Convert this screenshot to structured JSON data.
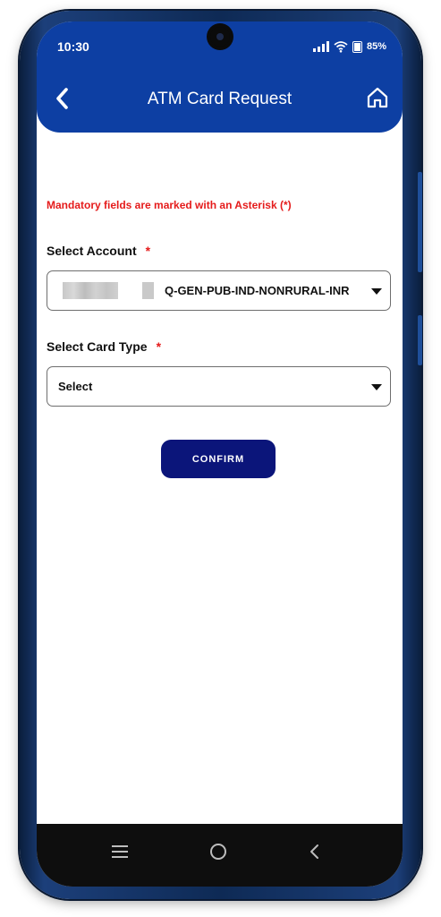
{
  "status_bar": {
    "time": "10:30",
    "battery_percent": "85%",
    "icons": [
      "signal-icon",
      "wifi-icon",
      "battery-icon"
    ]
  },
  "app_bar": {
    "title": "ATM Card Request",
    "back_icon": "chevron-left-icon",
    "home_icon": "home-icon"
  },
  "form": {
    "mandatory_note": "Mandatory fields are marked with an Asterisk (*)",
    "account": {
      "label": "Select Account",
      "required_marker": "*",
      "selected_value": "Q-GEN-PUB-IND-NONRURAL-INR"
    },
    "card_type": {
      "label": "Select Card Type",
      "required_marker": "*",
      "selected_value": "Select"
    },
    "confirm_label": "CONFIRM"
  },
  "navigation": {
    "buttons": [
      "menu-icon",
      "home-circle-icon",
      "back-icon"
    ]
  },
  "colors": {
    "header": "#0d3fa3",
    "confirm_button": "#0b157a",
    "required": "#e51b1b"
  }
}
